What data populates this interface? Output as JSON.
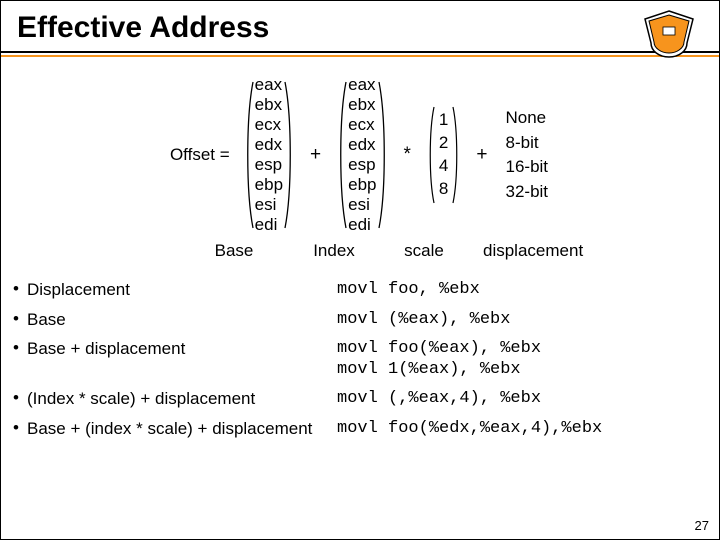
{
  "title": "Effective Address",
  "formula": {
    "lhs": "Offset =",
    "op_plus": "+",
    "op_star": "*",
    "base_regs": [
      "eax",
      "ebx",
      "ecx",
      "edx",
      "esp",
      "ebp",
      "esi",
      "edi"
    ],
    "index_regs": [
      "eax",
      "ebx",
      "ecx",
      "edx",
      "esp",
      "ebp",
      "esi",
      "edi"
    ],
    "scales": [
      "1",
      "2",
      "4",
      "8"
    ],
    "displacements": [
      "None",
      "8-bit",
      "16-bit",
      "32-bit"
    ],
    "labels": {
      "base": "Base",
      "index": "Index",
      "scale": "scale",
      "disp": "displacement"
    }
  },
  "bullets": [
    {
      "desc": "Displacement",
      "code": "movl foo, %ebx"
    },
    {
      "desc": "Base",
      "code": "movl (%eax), %ebx"
    },
    {
      "desc": "Base + displacement",
      "code": "movl foo(%eax), %ebx\nmovl 1(%eax), %ebx"
    },
    {
      "desc": "(Index * scale) + displacement",
      "code": "movl (,%eax,4), %ebx"
    },
    {
      "desc": "Base + (index * scale) + displacement",
      "code": "movl foo(%edx,%eax,4),%ebx"
    }
  ],
  "pagenum": "27"
}
